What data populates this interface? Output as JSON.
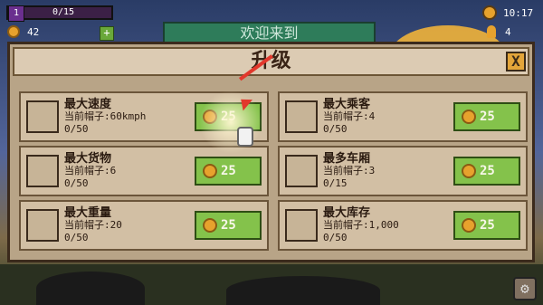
{
  "hud": {
    "level": "1",
    "progress_text": "0/15",
    "progress_fraction": 0.0,
    "coins": "42",
    "plus_label": "+",
    "time": "10:17",
    "people": "4"
  },
  "welcome_text": "欢迎来到",
  "dialog": {
    "title": "升级",
    "close_label": "X"
  },
  "cards": [
    {
      "name": "最大速度",
      "current": "当前帽子:60kmph",
      "level": "0/50",
      "price": "25",
      "icon": "speedometer-icon"
    },
    {
      "name": "最大乘客",
      "current": "当前帽子:4",
      "level": "0/50",
      "price": "25",
      "icon": "passenger-icon"
    },
    {
      "name": "最大货物",
      "current": "当前帽子:6",
      "level": "0/50",
      "price": "25",
      "icon": "cargo-icon"
    },
    {
      "name": "最多车厢",
      "current": "当前帽子:3",
      "level": "0/15",
      "price": "25",
      "icon": "train-car-icon"
    },
    {
      "name": "最大重量",
      "current": "当前帽子:20",
      "level": "0/50",
      "price": "25",
      "icon": "weight-icon"
    },
    {
      "name": "最大库存",
      "current": "当前帽子:1,000",
      "level": "0/50",
      "price": "25",
      "icon": "safe-icon"
    }
  ],
  "colors": {
    "dialog_bg": "#b8a487",
    "button_green": "#84c24b",
    "coin_gold": "#e7a22d",
    "arrow_red": "#e2382c"
  }
}
